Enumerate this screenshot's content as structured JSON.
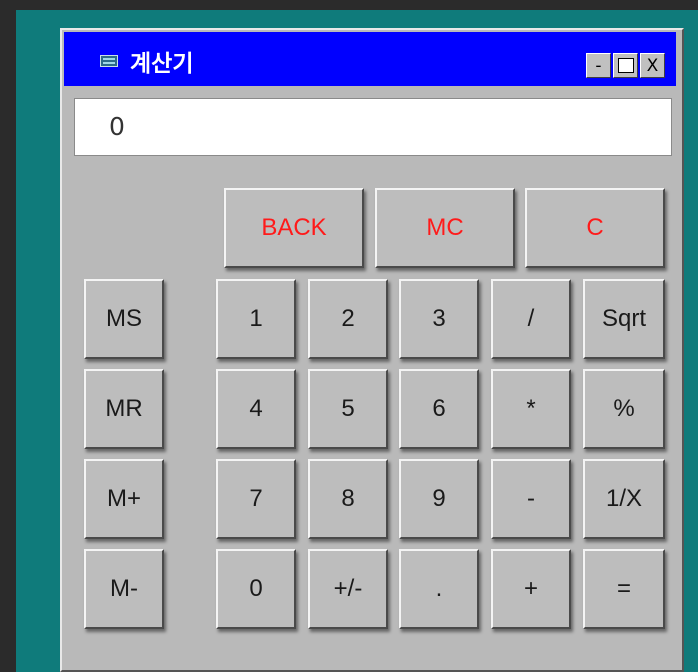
{
  "window": {
    "title": "계산기",
    "minimize_label": "-",
    "close_label": "X"
  },
  "display": {
    "value": "0"
  },
  "top_buttons": [
    "BACK",
    "MC",
    "C"
  ],
  "memory_buttons": [
    "MS",
    "MR",
    "M+",
    "M-"
  ],
  "keypad": [
    [
      "1",
      "2",
      "3",
      "/",
      "Sqrt"
    ],
    [
      "4",
      "5",
      "6",
      "*",
      "%"
    ],
    [
      "7",
      "8",
      "9",
      "-",
      "1/X"
    ],
    [
      "0",
      "+/-",
      ".",
      "+",
      "="
    ]
  ],
  "colors": {
    "titlebar": "#0000ff",
    "desktop": "#0f7b7b",
    "button_face": "#bdbdbd",
    "top_button_text": "#ff1a1a"
  }
}
